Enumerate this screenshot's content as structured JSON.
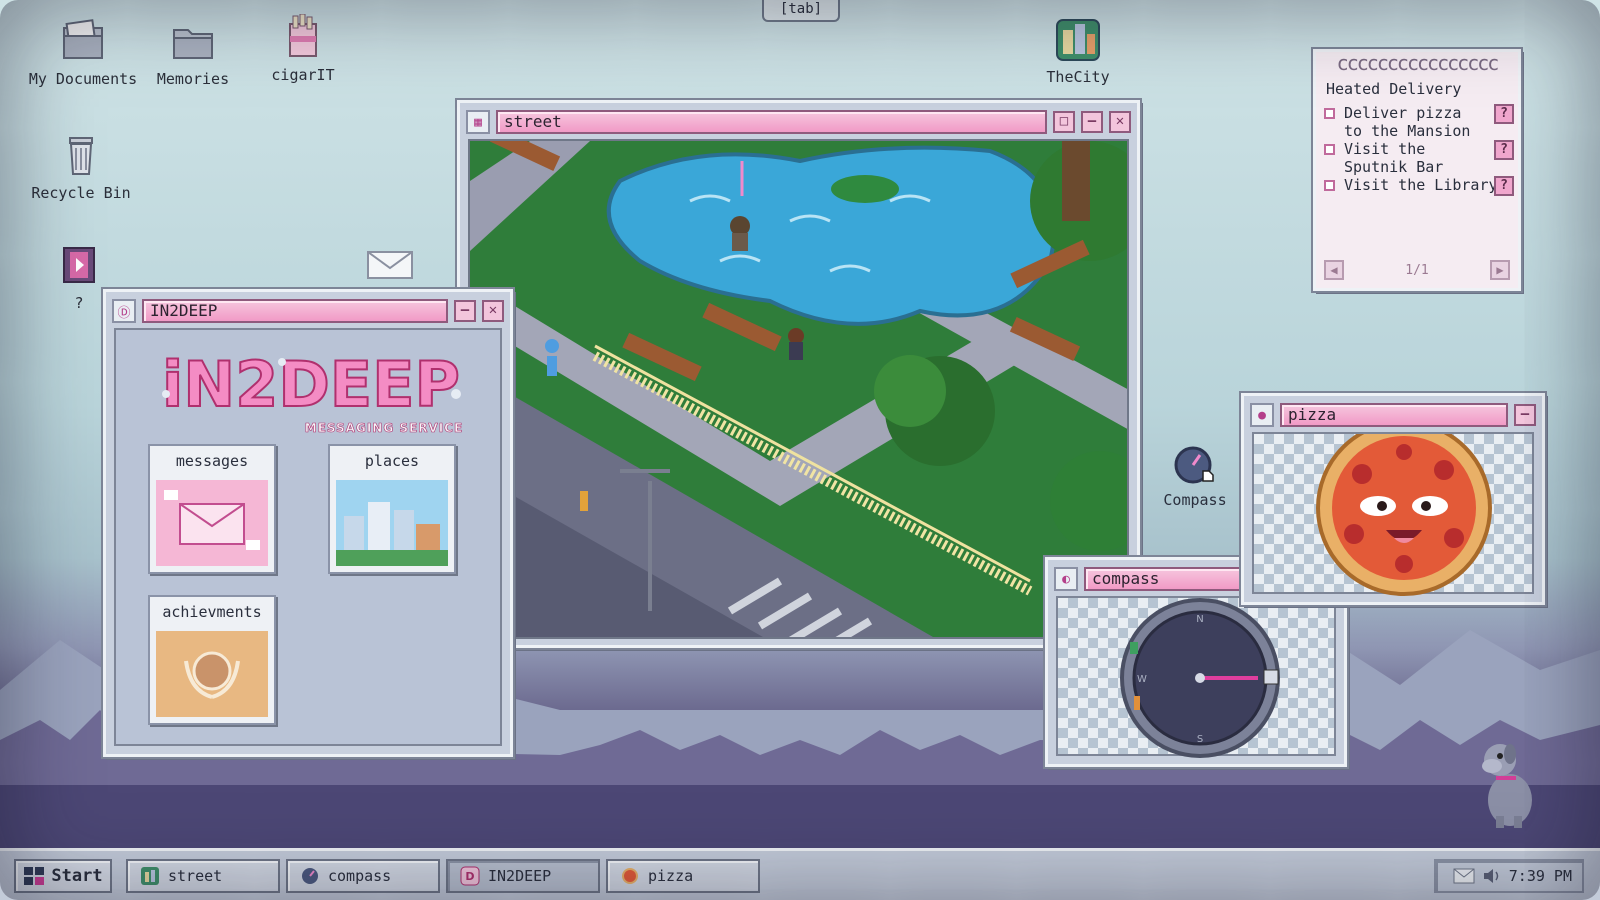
{
  "tab_hint": "[tab]",
  "desktop_icons": {
    "my_documents": "My Documents",
    "memories": "Memories",
    "cigarit": "cigarIT",
    "recycle_bin": "Recycle Bin",
    "unknown": "?",
    "thecity": "TheCity",
    "compass": "Compass"
  },
  "windows": {
    "street": {
      "title": "street"
    },
    "in2deep": {
      "title": "IN2DEEP",
      "logo_main": "iN2DEEP",
      "logo_sub": "MESSAGING SERVICE",
      "tiles": {
        "messages": "messages",
        "places": "places",
        "achievements": "achievments"
      }
    },
    "notes": {
      "rings": "cccccccccccccccc",
      "title": "Heated Delivery",
      "tasks": [
        {
          "text": "Deliver pizza to the Mansion",
          "hint": "?"
        },
        {
          "text": "Visit the Sputnik Bar",
          "hint": "?"
        },
        {
          "text": "Visit the Library",
          "hint": "?"
        }
      ],
      "pager": "1/1"
    },
    "pizza": {
      "title": "pizza"
    },
    "compass": {
      "title": "compass"
    }
  },
  "taskbar": {
    "start": "Start",
    "items": [
      "street",
      "compass",
      "IN2DEEP",
      "pizza"
    ],
    "active_item": "IN2DEEP",
    "clock": "7:39 PM"
  },
  "colors": {
    "title_pink": "#f19ac6",
    "window_gray": "#c8d0de",
    "accent_magenta": "#d23d97"
  }
}
